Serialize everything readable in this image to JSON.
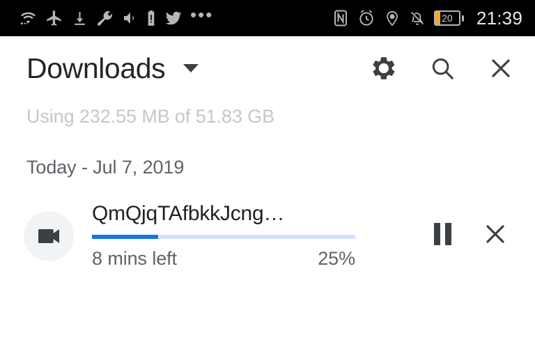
{
  "statusbar": {
    "left_icons": [
      {
        "name": "wifi-icon",
        "label": "wifi"
      },
      {
        "name": "airplane-mode-icon",
        "label": "airplane mode"
      },
      {
        "name": "download-icon",
        "label": "download"
      },
      {
        "name": "wrench-icon",
        "label": "developer tools"
      },
      {
        "name": "volume-icon",
        "label": "volume"
      },
      {
        "name": "battery-alert-icon",
        "label": "battery alert"
      },
      {
        "name": "twitter-icon",
        "label": "twitter"
      },
      {
        "name": "more-icon",
        "label": "more notifications"
      }
    ],
    "right_icons": [
      {
        "name": "nfc-icon",
        "label": "nfc"
      },
      {
        "name": "alarm-icon",
        "label": "alarm"
      },
      {
        "name": "location-icon",
        "label": "location"
      },
      {
        "name": "notifications-off-icon",
        "label": "notifications muted"
      }
    ],
    "more_glyph": "•••",
    "battery": {
      "percent_label": "20",
      "fill_percent": 20,
      "fill_color": "#f5a623"
    },
    "clock": "21:39"
  },
  "appbar": {
    "title": "Downloads",
    "dropdown_name": "downloads-filter-dropdown",
    "actions": [
      {
        "name": "settings-button",
        "icon": "gear-icon"
      },
      {
        "name": "search-button",
        "icon": "search-icon"
      },
      {
        "name": "close-button",
        "icon": "close-icon"
      }
    ]
  },
  "storage": {
    "text": "Using 232.55 MB of 51.83 GB"
  },
  "sections": [
    {
      "date_header": "Today - Jul 7, 2019",
      "items": [
        {
          "file_name": "QmQjqTAfbkkJcng…",
          "file_icon": "video-camera-icon",
          "time_left": "8 mins left",
          "percent_label": "25%",
          "percent": 25,
          "progress_color": "#1a73e8",
          "track_color": "#d2e3fc",
          "pause_action": "pause-download-button",
          "cancel_action": "cancel-download-button"
        }
      ]
    }
  ]
}
